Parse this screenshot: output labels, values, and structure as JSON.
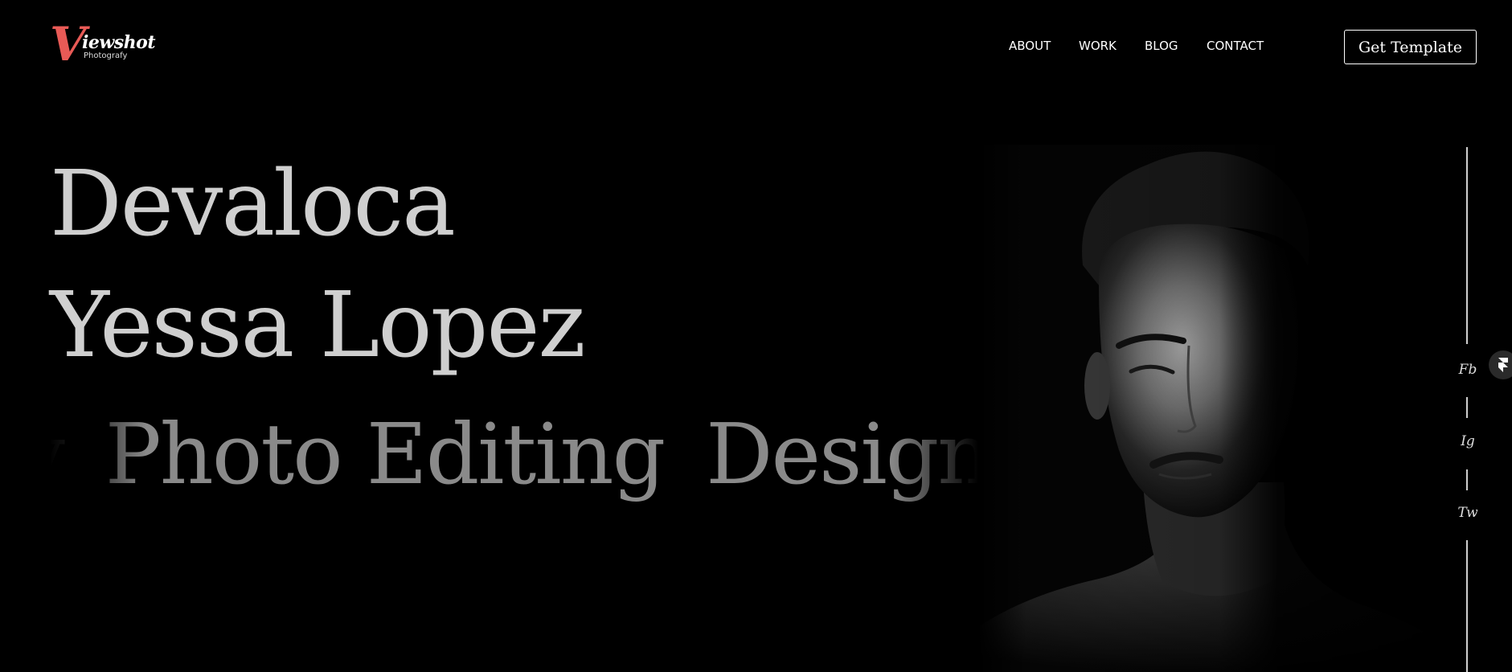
{
  "brand": {
    "logo_letter": "V",
    "logo_word": "iewshot",
    "logo_sub": "Photografy",
    "accent_color": "#e85a56"
  },
  "nav": {
    "items": [
      "ABOUT",
      "WORK",
      "BLOG",
      "CONTACT"
    ],
    "cta_label": "Get Template"
  },
  "hero": {
    "name_line1": "Devaloca",
    "name_line2": "Yessa Lopez",
    "services": [
      "y",
      "Photo Editing",
      "Design"
    ]
  },
  "social": {
    "links": [
      "Fb",
      "Ig",
      "Tw"
    ]
  },
  "icons": {
    "framer_badge": "framer-icon",
    "portrait": "portrait-photo"
  }
}
